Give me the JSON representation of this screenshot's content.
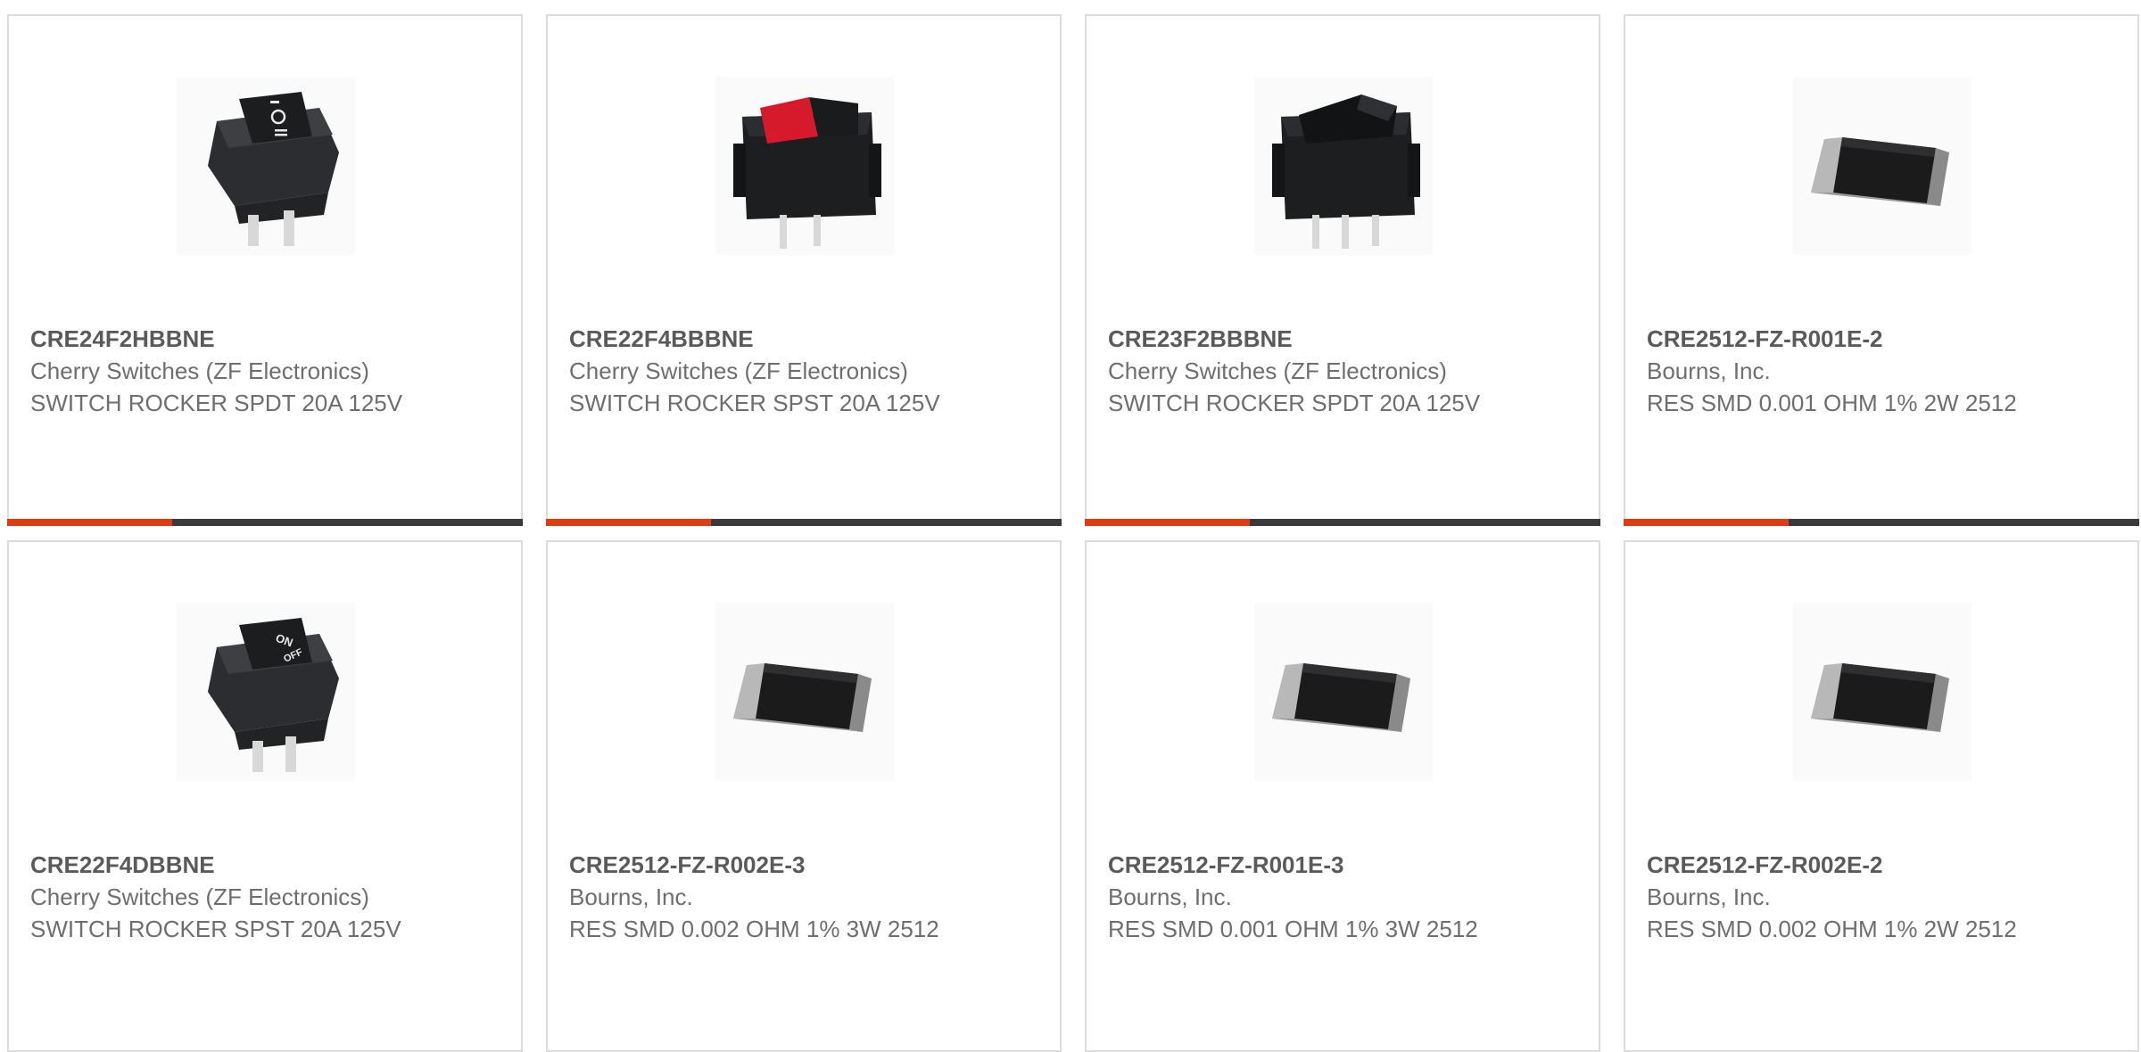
{
  "colors": {
    "accent": "#e03c14",
    "bar_track": "#3a3a3a",
    "card_border": "#dcdcdc",
    "text": "#6e6e6e"
  },
  "products": [
    {
      "part_number": "CRE24F2HBBNE",
      "manufacturer": "Cherry Switches (ZF Electronics)",
      "description": "SWITCH ROCKER SPDT 20A 125V",
      "image_icon": "rocker-switch-black-icon",
      "progress_fraction": 0.32
    },
    {
      "part_number": "CRE22F4BBBNE",
      "manufacturer": "Cherry Switches (ZF Electronics)",
      "description": "SWITCH ROCKER SPST 20A 125V",
      "image_icon": "rocker-switch-red-icon",
      "progress_fraction": 0.32
    },
    {
      "part_number": "CRE23F2BBBNE",
      "manufacturer": "Cherry Switches (ZF Electronics)",
      "description": "SWITCH ROCKER SPDT 20A 125V",
      "image_icon": "rocker-switch-plain-icon",
      "progress_fraction": 0.32
    },
    {
      "part_number": "CRE2512-FZ-R001E-2",
      "manufacturer": "Bourns, Inc.",
      "description": "RES SMD 0.001 OHM 1% 2W 2512",
      "image_icon": "smd-resistor-icon",
      "progress_fraction": 0.32
    },
    {
      "part_number": "CRE22F4DBBNE",
      "manufacturer": "Cherry Switches (ZF Electronics)",
      "description": "SWITCH ROCKER SPST 20A 125V",
      "image_icon": "rocker-switch-on-off-icon"
    },
    {
      "part_number": "CRE2512-FZ-R002E-3",
      "manufacturer": "Bourns, Inc.",
      "description": "RES SMD 0.002 OHM 1% 3W 2512",
      "image_icon": "smd-resistor-icon"
    },
    {
      "part_number": "CRE2512-FZ-R001E-3",
      "manufacturer": "Bourns, Inc.",
      "description": "RES SMD 0.001 OHM 1% 3W 2512",
      "image_icon": "smd-resistor-icon"
    },
    {
      "part_number": "CRE2512-FZ-R002E-2",
      "manufacturer": "Bourns, Inc.",
      "description": "RES SMD 0.002 OHM 1% 2W 2512",
      "image_icon": "smd-resistor-icon"
    }
  ]
}
